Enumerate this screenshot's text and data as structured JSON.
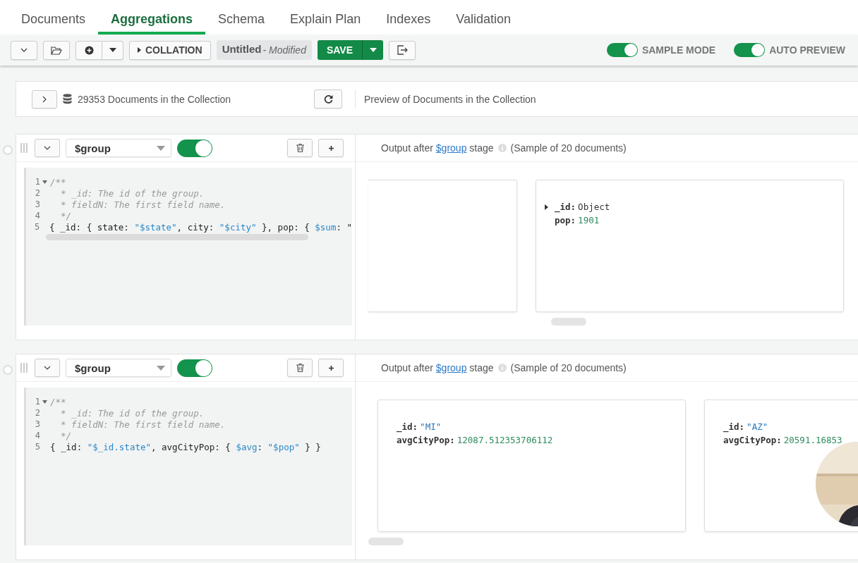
{
  "tabs": [
    {
      "label": "Documents",
      "selected": false
    },
    {
      "label": "Aggregations",
      "selected": true
    },
    {
      "label": "Schema",
      "selected": false
    },
    {
      "label": "Explain Plan",
      "selected": false
    },
    {
      "label": "Indexes",
      "selected": false
    },
    {
      "label": "Validation",
      "selected": false
    }
  ],
  "toolbar": {
    "collation": "COLLATION",
    "pipeline_name": "Untitled",
    "pipeline_status": "- Modified",
    "save": "SAVE",
    "toggles": [
      {
        "label": "SAMPLE MODE",
        "on": true
      },
      {
        "label": "AUTO PREVIEW",
        "on": true
      }
    ]
  },
  "collection_bar": {
    "count": "29353 Documents in the Collection",
    "preview": "Preview of Documents in the Collection"
  },
  "stages": [
    {
      "operator": "$group",
      "enabled": true,
      "editor_scrollbar": true,
      "code": [
        {
          "num": "1",
          "fold": true,
          "parts": [
            {
              "text": "/**",
              "kind": "comment"
            }
          ]
        },
        {
          "num": "2",
          "fold": false,
          "parts": [
            {
              "text": "  * _id: The id of the group.",
              "kind": "comment"
            }
          ]
        },
        {
          "num": "3",
          "fold": false,
          "parts": [
            {
              "text": "  * fieldN: The first field name.",
              "kind": "comment"
            }
          ]
        },
        {
          "num": "4",
          "fold": false,
          "parts": [
            {
              "text": "  */",
              "kind": "comment"
            }
          ]
        },
        {
          "num": "5",
          "fold": false,
          "parts": [
            {
              "text": "{ _id: { state: ",
              "kind": "plain"
            },
            {
              "text": "\"$state\"",
              "kind": "string"
            },
            {
              "text": ", city: ",
              "kind": "plain"
            },
            {
              "text": "\"$city\"",
              "kind": "string"
            },
            {
              "text": " }, pop: { ",
              "kind": "plain"
            },
            {
              "text": "$sum",
              "kind": "string"
            },
            {
              "text": ": \"",
              "kind": "plain"
            }
          ]
        }
      ],
      "output": {
        "prefix": "Output after",
        "link": "$group",
        "suffix": "stage",
        "note": "(Sample of 20 documents)"
      },
      "documents": [
        {
          "clipped_left": true
        },
        {
          "clipped_left": false,
          "fields": [
            {
              "key": "_id:",
              "value": "Object",
              "kind": "object"
            },
            {
              "key": "pop:",
              "value": "1901",
              "kind": "number"
            }
          ]
        }
      ]
    },
    {
      "operator": "$group",
      "enabled": true,
      "editor_scrollbar": false,
      "code": [
        {
          "num": "1",
          "fold": true,
          "parts": [
            {
              "text": "/**",
              "kind": "comment"
            }
          ]
        },
        {
          "num": "2",
          "fold": false,
          "parts": [
            {
              "text": "  * _id: The id of the group.",
              "kind": "comment"
            }
          ]
        },
        {
          "num": "3",
          "fold": false,
          "parts": [
            {
              "text": "  * fieldN: The first field name.",
              "kind": "comment"
            }
          ]
        },
        {
          "num": "4",
          "fold": false,
          "parts": [
            {
              "text": "  */",
              "kind": "comment"
            }
          ]
        },
        {
          "num": "5",
          "fold": false,
          "parts": [
            {
              "text": "{ _id: ",
              "kind": "plain"
            },
            {
              "text": "\"$_id.state\"",
              "kind": "string"
            },
            {
              "text": ", avgCityPop: { ",
              "kind": "plain"
            },
            {
              "text": "$avg",
              "kind": "string"
            },
            {
              "text": ": ",
              "kind": "plain"
            },
            {
              "text": "\"$pop\"",
              "kind": "string"
            },
            {
              "text": " } }",
              "kind": "plain"
            }
          ]
        }
      ],
      "output": {
        "prefix": "Output after",
        "link": "$group",
        "suffix": "stage",
        "note": "(Sample of 20 documents)"
      },
      "documents": [
        {
          "clipped_left": false,
          "fields": [
            {
              "key": "_id:",
              "value": "\"MI\"",
              "kind": "string"
            },
            {
              "key": "avgCityPop:",
              "value": "12087.512353706112",
              "kind": "number"
            }
          ]
        },
        {
          "clipped_left": false,
          "fields": [
            {
              "key": "_id:",
              "value": "\"AZ\"",
              "kind": "string"
            },
            {
              "key": "avgCityPop:",
              "value": "20591.16853",
              "kind": "number"
            }
          ]
        }
      ]
    }
  ]
}
